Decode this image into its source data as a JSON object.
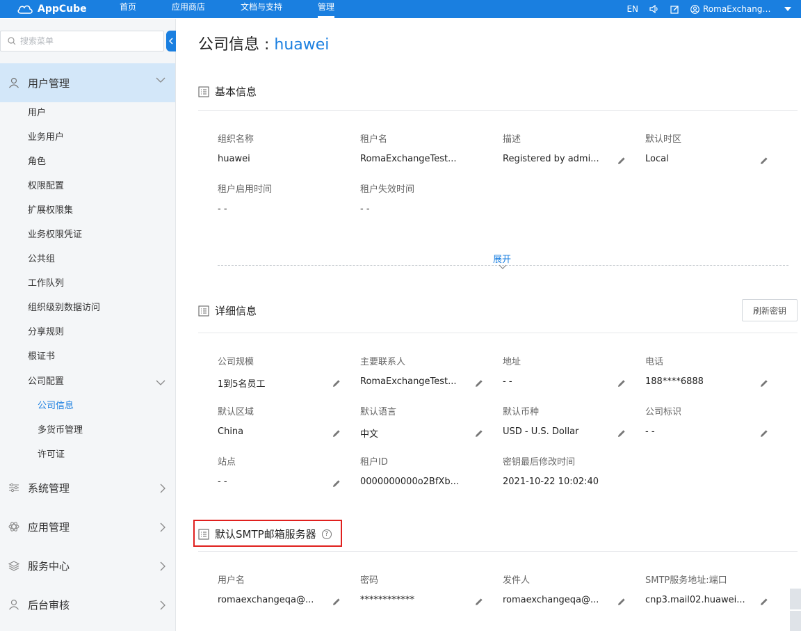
{
  "topbar": {
    "app_name": "AppCube",
    "nav": [
      "首页",
      "应用商店",
      "文档与支持",
      "管理"
    ],
    "active_nav": "管理",
    "lang": "EN",
    "user": "RomaExchangeT..."
  },
  "sidebar": {
    "search_placeholder": "搜索菜单",
    "groups": [
      {
        "label": "用户管理",
        "expanded": true
      },
      {
        "label": "系统管理"
      },
      {
        "label": "应用管理"
      },
      {
        "label": "服务中心"
      },
      {
        "label": "后台审核"
      }
    ],
    "user_mgmt_items": [
      "用户",
      "业务用户",
      "角色",
      "权限配置",
      "扩展权限集",
      "业务权限凭证",
      "公共组",
      "工作队列",
      "组织级别数据访问",
      "分享规则",
      "根证书",
      "公司配置"
    ],
    "company_config_items": [
      "公司信息",
      "多货币管理",
      "许可证"
    ],
    "current_item": "公司信息"
  },
  "page": {
    "title_prefix": "公司信息 : ",
    "tenant": "huawei"
  },
  "basic": {
    "title": "基本信息",
    "fields": [
      {
        "label": "组织名称",
        "value": "huawei",
        "editable": false
      },
      {
        "label": "租户名",
        "value": "RomaExchangeTest...",
        "editable": false
      },
      {
        "label": "描述",
        "value": "Registered by admi...",
        "editable": true
      },
      {
        "label": "默认时区",
        "value": "Local",
        "editable": true
      },
      {
        "label": "租户启用时间",
        "value": "- -",
        "editable": false
      },
      {
        "label": "租户失效时间",
        "value": "- -",
        "editable": false
      }
    ],
    "expand_label": "展开"
  },
  "detail": {
    "title": "详细信息",
    "refresh_button": "刷新密钥",
    "fields": [
      {
        "label": "公司规模",
        "value": "1到5名员工",
        "editable": true
      },
      {
        "label": "主要联系人",
        "value": "RomaExchangeTest...",
        "editable": true
      },
      {
        "label": "地址",
        "value": "- -",
        "editable": true
      },
      {
        "label": "电话",
        "value": "188****6888",
        "editable": true
      },
      {
        "label": "默认区域",
        "value": "China",
        "editable": true
      },
      {
        "label": "默认语言",
        "value": "中文",
        "editable": true
      },
      {
        "label": "默认币种",
        "value": "USD - U.S. Dollar",
        "editable": true
      },
      {
        "label": "公司标识",
        "value": "- -",
        "editable": true
      },
      {
        "label": "站点",
        "value": "- -",
        "editable": true
      },
      {
        "label": "租户ID",
        "value": "0000000000o2BfXb...",
        "editable": false
      },
      {
        "label": "密钥最后修改时间",
        "value": "2021-10-22 10:02:40",
        "editable": false
      }
    ]
  },
  "smtp": {
    "title": "默认SMTP邮箱服务器",
    "help": "?",
    "fields": [
      {
        "label": "用户名",
        "value": "romaexchangeqa@...",
        "editable": true
      },
      {
        "label": "密码",
        "value": "************",
        "editable": true
      },
      {
        "label": "发件人",
        "value": "romaexchangeqa@...",
        "editable": true
      },
      {
        "label": "SMTP服务地址:端口",
        "value": "cnp3.mail02.huawei...",
        "editable": true
      }
    ]
  },
  "colors": {
    "accent": "#1a7fe0",
    "highlight": "#e0201e",
    "sidebar_active": "#d3e7f9"
  }
}
